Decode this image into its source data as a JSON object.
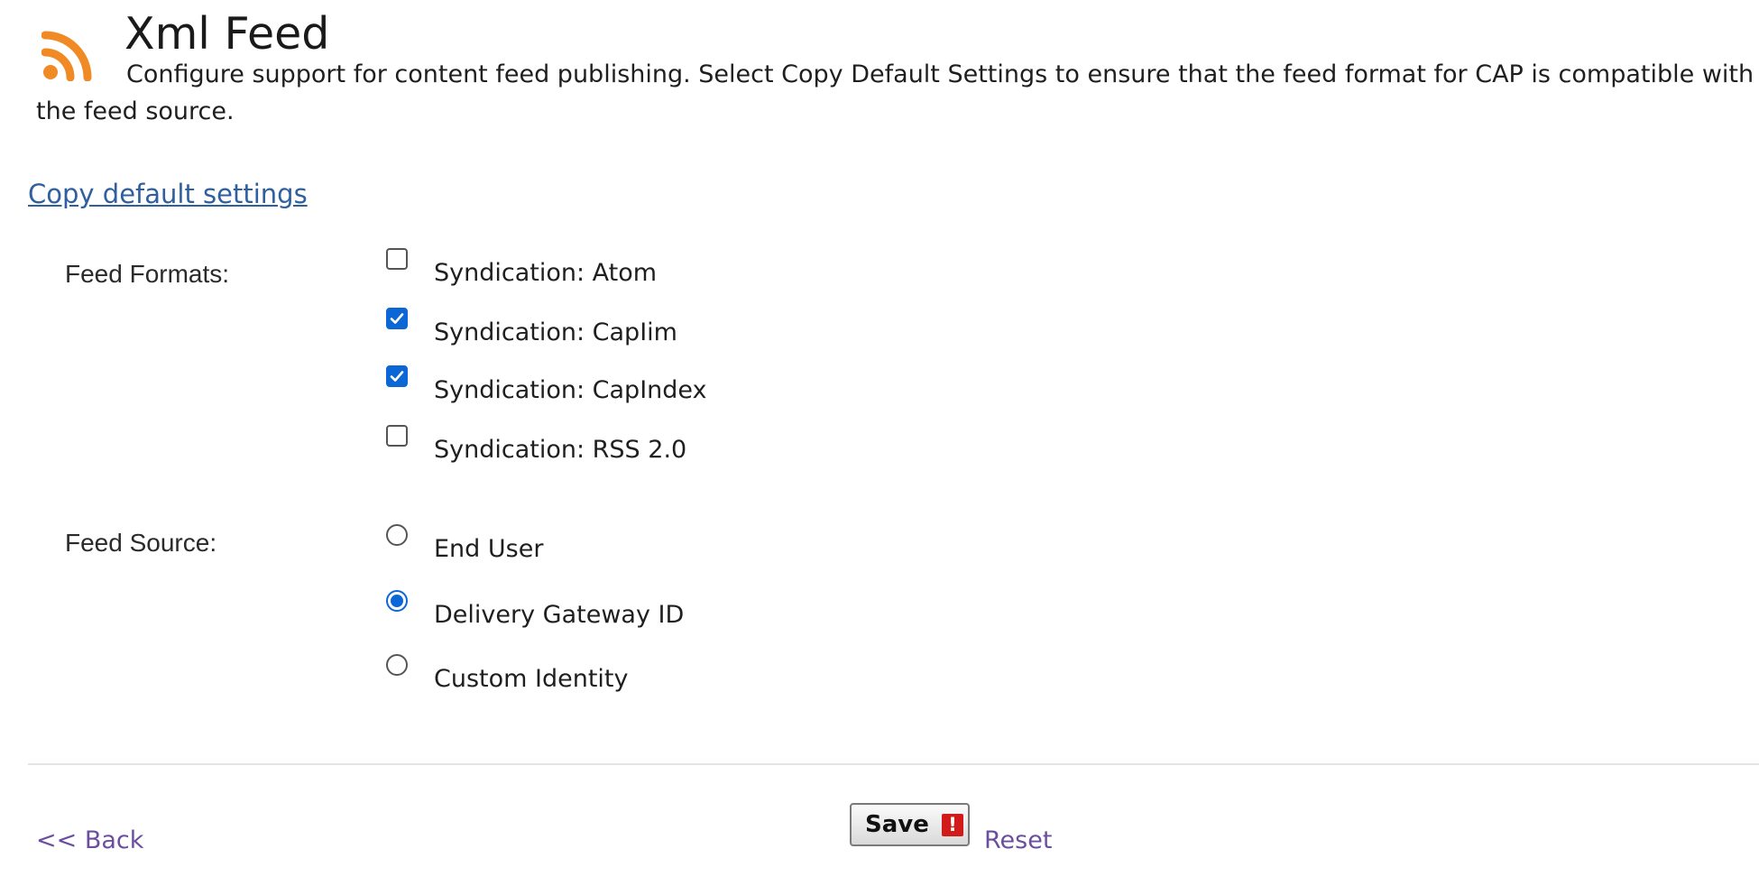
{
  "header": {
    "icon": "rss-feed-icon",
    "title": "Xml Feed",
    "description": "Configure support for content feed publishing. Select Copy Default Settings to ensure that the feed format for CAP is compatible with the feed source."
  },
  "copy_link": "Copy default settings",
  "feed_formats": {
    "label": "Feed Formats:",
    "options": [
      {
        "label": "Syndication: Atom",
        "checked": false
      },
      {
        "label": "Syndication: CapIim",
        "checked": true
      },
      {
        "label": "Syndication: CapIndex",
        "checked": true
      },
      {
        "label": "Syndication: RSS 2.0",
        "checked": false
      }
    ]
  },
  "feed_source": {
    "label": "Feed Source:",
    "options": [
      {
        "label": "End User",
        "selected": false
      },
      {
        "label": "Delivery Gateway ID",
        "selected": true
      },
      {
        "label": "Custom Identity",
        "selected": false
      }
    ]
  },
  "footer": {
    "back_label": "<< Back",
    "save_label": "Save",
    "save_icon": "alert-icon",
    "save_icon_glyph": "!",
    "reset_label": "Reset"
  },
  "colors": {
    "accent": "#0b66d6",
    "link": "#2f5f9e",
    "visited_link": "#6b4f9e",
    "rss_orange": "#f08a24",
    "alert_red": "#d11a1a"
  }
}
